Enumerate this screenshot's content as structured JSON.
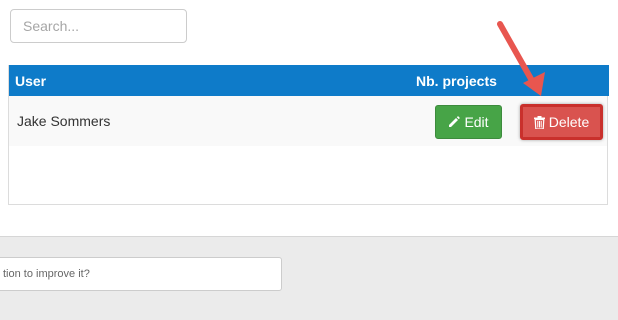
{
  "search": {
    "placeholder": "Search..."
  },
  "table": {
    "headers": {
      "user": "User",
      "projects": "Nb. projects"
    },
    "rows": [
      {
        "user": "Jake Sommers",
        "projects": ""
      }
    ],
    "edit_label": "Edit",
    "delete_label": "Delete"
  },
  "footer": {
    "feedback_placeholder": "tion to improve it?"
  },
  "colors": {
    "header": "#0e7bc9",
    "edit": "#47a447",
    "delete": "#d9534f",
    "arrow": "#e8564f"
  },
  "icons": {
    "edit": "pencil-icon",
    "delete": "trash-icon",
    "annotation": "arrow-pointer-icon"
  }
}
